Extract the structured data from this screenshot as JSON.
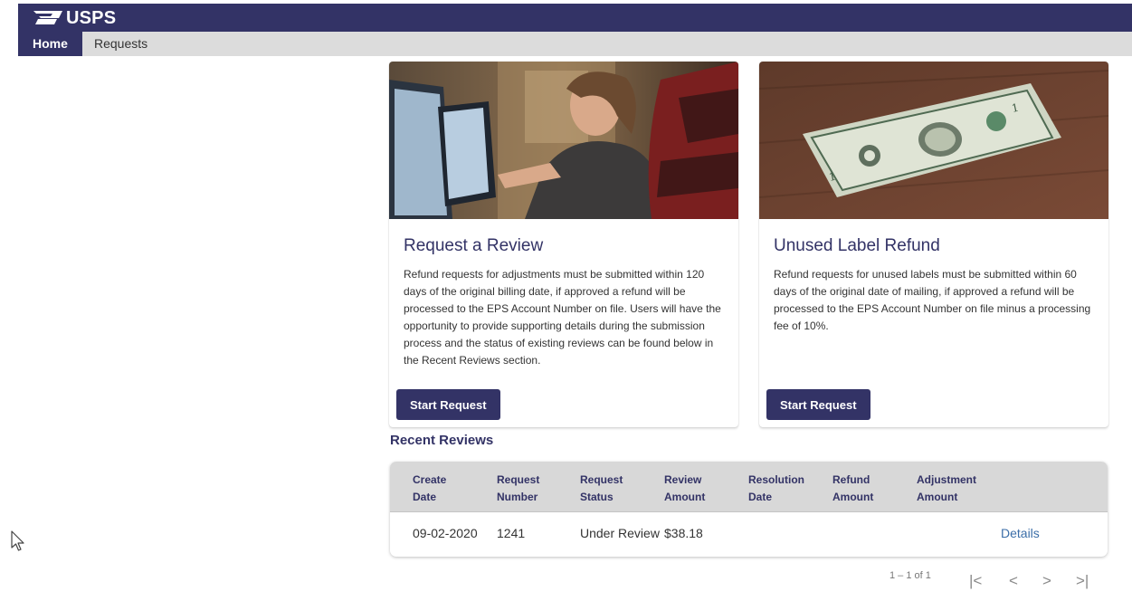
{
  "header": {
    "brand": "USPS",
    "brand_color": "#333366",
    "logo_icon": "usps-eagle-icon"
  },
  "nav": {
    "tabs": [
      {
        "label": "Home",
        "active": true
      },
      {
        "label": "Requests",
        "active": false
      }
    ]
  },
  "cards": [
    {
      "title": "Request a Review",
      "body": "Refund requests for adjustments must be submitted within 120 days of the original billing date, if approved a refund will be processed to the EPS Account Number on file. Users will have the opportunity to provide supporting details during the submission process and the status of existing reviews can be found below in the Recent Reviews section.",
      "button_label": "Start Request",
      "image": "woman-at-computer-photo"
    },
    {
      "title": "Unused Label Refund",
      "body": "Refund requests for unused labels must be submitted within 60 days of the original date of mailing, if approved a refund will be processed to the EPS Account Number on file minus a processing fee of 10%.",
      "button_label": "Start Request",
      "image": "dollar-bill-photo"
    }
  ],
  "recent_reviews": {
    "title": "Recent Reviews",
    "columns": [
      [
        "Create",
        "Date"
      ],
      [
        "Request",
        "Number"
      ],
      [
        "Request",
        "Status"
      ],
      [
        "Review",
        "Amount"
      ],
      [
        "Resolution",
        "Date"
      ],
      [
        "Refund",
        "Amount"
      ],
      [
        "Adjustment",
        "Amount"
      ]
    ],
    "rows": [
      {
        "create_date": "09-02-2020",
        "request_number": "1241",
        "request_status": "Under Review",
        "review_amount": "$38.18",
        "resolution_date": "",
        "refund_amount": "",
        "adjustment_amount": "",
        "action": "Details"
      }
    ]
  },
  "pagination": {
    "range": "1 – 1 of 1",
    "first_icon": "first-page-icon",
    "prev_icon": "prev-page-icon",
    "next_icon": "next-page-icon",
    "last_icon": "last-page-icon"
  }
}
